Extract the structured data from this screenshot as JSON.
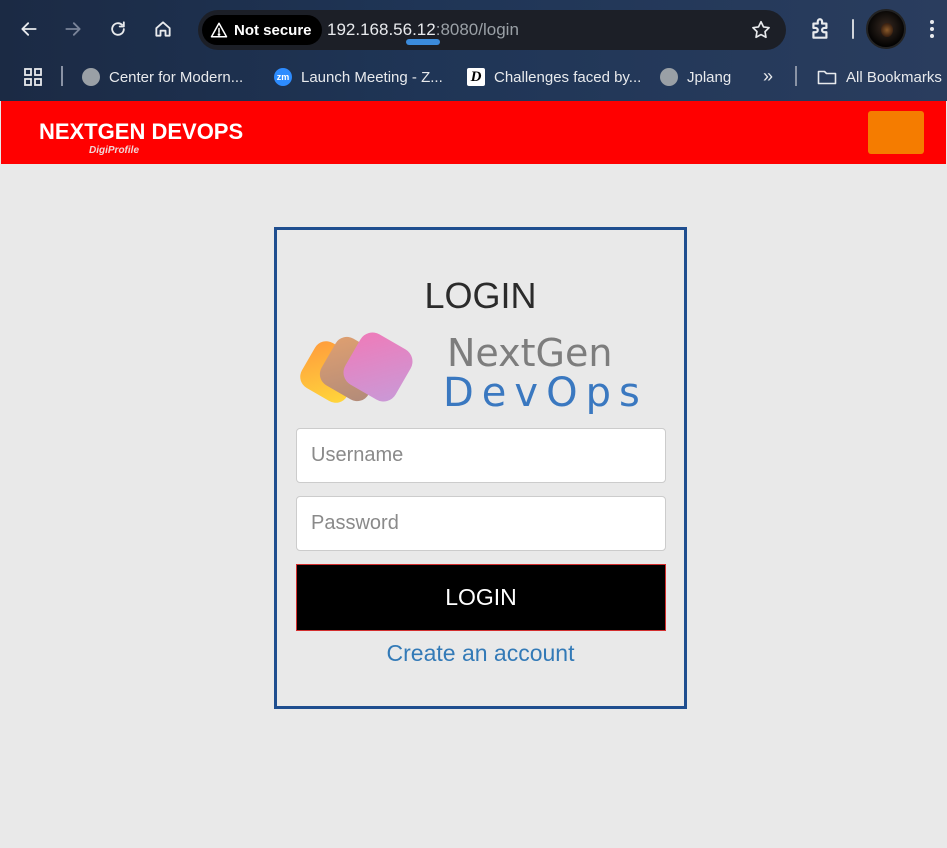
{
  "browser": {
    "security_label": "Not secure",
    "url_host": "192.168.56.12",
    "url_rest": ":8080/login",
    "bookmarks": [
      {
        "label": "Center for Modern...",
        "icon": "globe-icon"
      },
      {
        "label": "Launch Meeting - Z...",
        "icon": "zoom-icon",
        "icon_text": "zm"
      },
      {
        "label": "Challenges faced by...",
        "icon": "d-icon",
        "icon_text": "D"
      },
      {
        "label": "Jplang",
        "icon": "globe-icon"
      }
    ],
    "overflow_label": "»",
    "all_bookmarks_label": "All Bookmarks"
  },
  "navbar": {
    "brand": "NEXTGEN DEVOPS",
    "brand_sub": "DigiProfile",
    "accent_color": "#ff0000",
    "button_color": "#f57c00"
  },
  "login": {
    "title": "LOGIN",
    "logo_text_top": "NextGen",
    "logo_text_bottom": "DevOps",
    "username_placeholder": "Username",
    "password_placeholder": "Password",
    "submit_label": "LOGIN",
    "create_account_label": "Create an account"
  }
}
